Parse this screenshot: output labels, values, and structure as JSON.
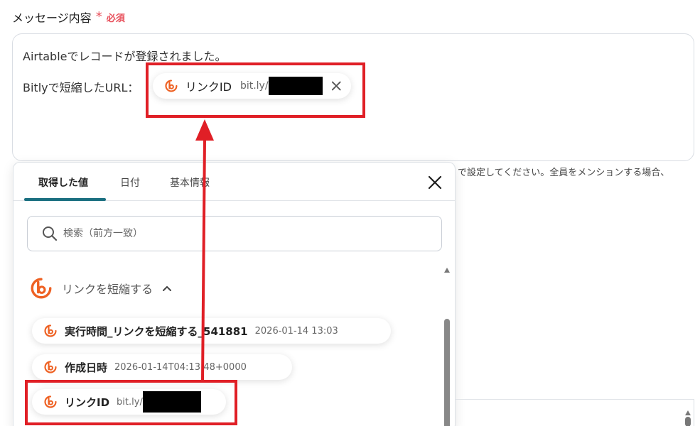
{
  "field": {
    "label": "メッセージ内容",
    "required_star": "*",
    "required_text": "必須"
  },
  "message": {
    "line1": "Airtableでレコードが登録されました。",
    "line2_prefix": "Bitlyで短縮したURL：",
    "chip": {
      "label": "リンクID",
      "value": "bit.ly/",
      "value_redacted": true
    }
  },
  "hint_text": "で設定してください。全員をメンションする場合、",
  "panel": {
    "tabs": [
      {
        "label": "取得した値",
        "active": true
      },
      {
        "label": "日付",
        "active": false
      },
      {
        "label": "基本情報",
        "active": false
      }
    ],
    "search_placeholder": "検索（前方一致）",
    "group": {
      "title": "リンクを短縮する",
      "expanded": true,
      "items": [
        {
          "label": "実行時間_リンクを短縮する_541881",
          "value": "2026-01-14 13:03"
        },
        {
          "label": "作成日時",
          "value": "2026-01-14T04:13:48+0000"
        },
        {
          "label": "リンクID",
          "value": "bit.ly/",
          "value_redacted": true
        }
      ]
    }
  },
  "icons": {
    "brand": "bitly-icon",
    "search": "search-icon",
    "close": "close-icon",
    "chevron": "chevron-up-icon"
  },
  "colors": {
    "required": "#e8505b",
    "tab_accent": "#1a6f80",
    "bitly_orange": "#ee6123",
    "highlight": "#e01f26"
  }
}
